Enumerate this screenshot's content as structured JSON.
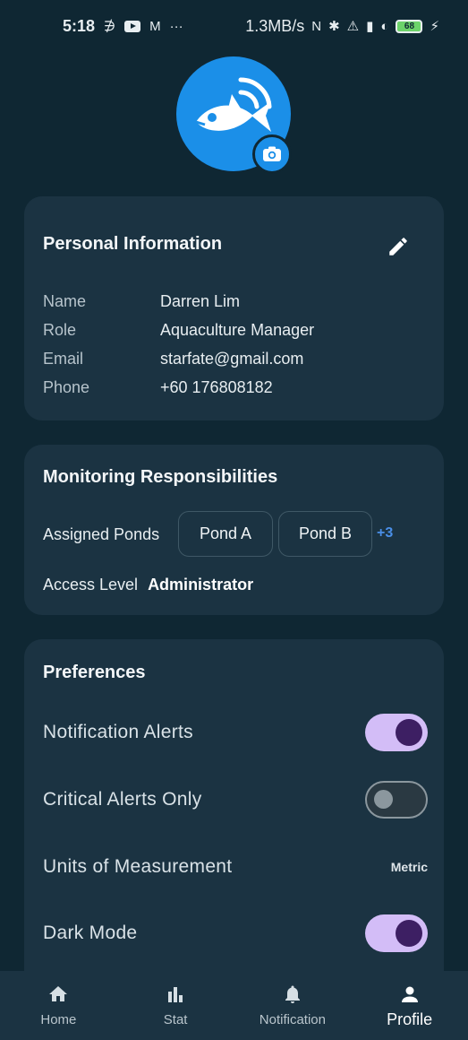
{
  "status_bar": {
    "time": "5:18",
    "speed": "1.3MB/s",
    "battery": "68"
  },
  "profile": {
    "avatar_icon": "fish-logo-icon",
    "camera_icon": "camera-icon"
  },
  "personal_info": {
    "title": "Personal Information",
    "edit_icon": "pencil-icon",
    "rows": [
      {
        "label": "Name",
        "value": "Darren Lim"
      },
      {
        "label": "Role",
        "value": "Aquaculture Manager"
      },
      {
        "label": "Email",
        "value": "starfate@gmail.com"
      },
      {
        "label": "Phone",
        "value": "+60 176808182"
      }
    ]
  },
  "monitoring": {
    "title": "Monitoring Responsibilities",
    "assigned_label": "Assigned Ponds",
    "ponds": [
      "Pond A",
      "Pond B"
    ],
    "more": "+3",
    "access_label": "Access Level",
    "access_value": "Administrator"
  },
  "preferences": {
    "title": "Preferences",
    "items": [
      {
        "label": "Notification Alerts",
        "enabled": true
      },
      {
        "label": "Critical Alerts Only",
        "enabled": false
      },
      {
        "label": "Units of Measurement",
        "value": "Metric"
      },
      {
        "label": "Dark Mode",
        "enabled": true
      }
    ],
    "toggle_on_color": "#d3bdf7",
    "knob_on_color": "#3d1f63"
  },
  "nav": {
    "items": [
      {
        "label": "Home",
        "icon": "home-icon"
      },
      {
        "label": "Stat",
        "icon": "bar-chart-icon"
      },
      {
        "label": "Notification",
        "icon": "bell-icon"
      },
      {
        "label": "Profile",
        "icon": "person-icon",
        "active": true
      }
    ]
  },
  "colors": {
    "background": "#0f2733",
    "card": "#1b3342",
    "accent": "#1b8fe8",
    "link": "#4a8fe8"
  }
}
